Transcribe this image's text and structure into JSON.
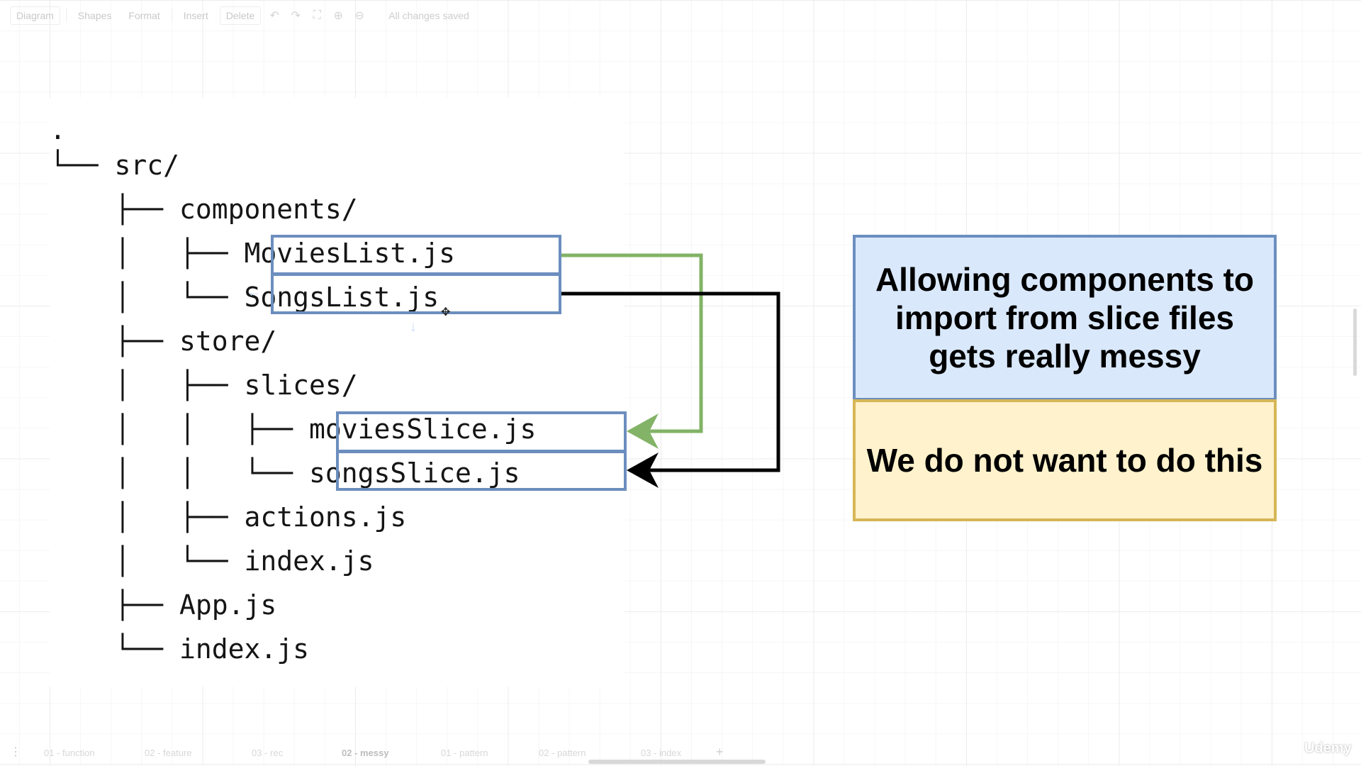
{
  "toolbar": {
    "diagram_menu": "Diagram",
    "shapes": "Shapes",
    "format": "Format",
    "insert": "Insert",
    "delete": "Delete",
    "status": "All changes saved"
  },
  "tree": {
    "lines": [
      ".",
      "└── src/",
      "    ├── components/",
      "    │   ├── MoviesList.js",
      "    │   └── SongsList.js",
      "    ├── store/",
      "    │   ├── slices/",
      "    │   │   ├── moviesSlice.js",
      "    │   │   └── songsSlice.js",
      "    │   ├── actions.js",
      "    │   └── index.js",
      "    ├── App.js",
      "    └── index.js"
    ]
  },
  "arrows": {
    "green_color": "#82b366",
    "black_color": "#000000",
    "box_border_color": "#6c8ebf"
  },
  "notes": {
    "blue_text": "Allowing components to import from slice files gets really messy",
    "yellow_text": "We do not want to do this",
    "blue_fill": "#dae8fc",
    "yellow_fill": "#fff2cc"
  },
  "pages": {
    "tabs": [
      "01 - function",
      "02 - feature",
      "03 - rec",
      "02 - messy",
      "01 - pattern",
      "02 - pattern",
      "03 - index"
    ],
    "active": "02 - messy"
  },
  "watermark": "Udemy"
}
